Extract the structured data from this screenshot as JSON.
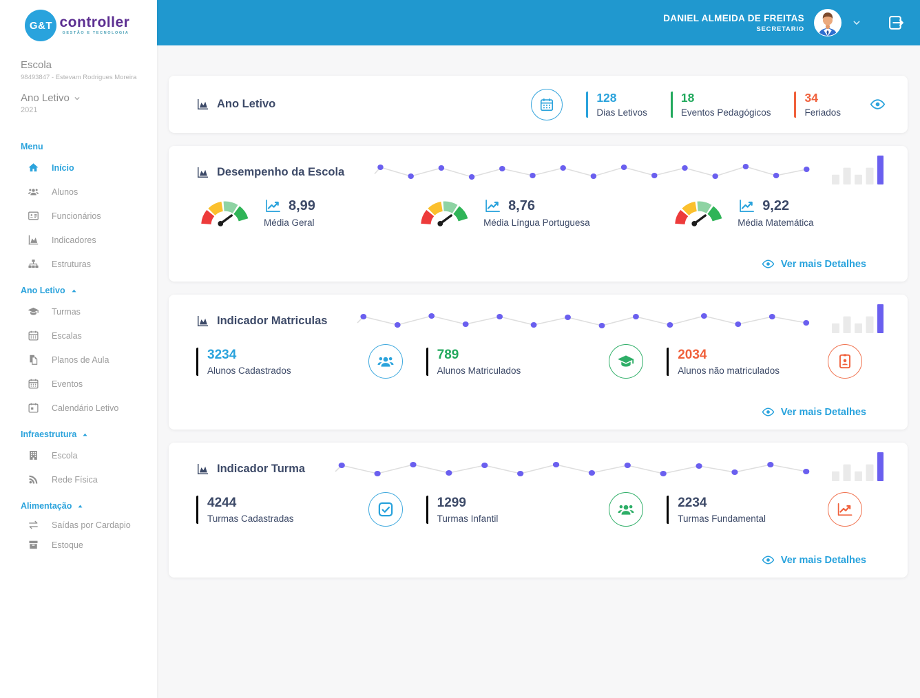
{
  "brand": {
    "circle_text": "G&T",
    "name": "controller",
    "tagline": "GESTÃO E TECNOLOGIA"
  },
  "sidebar": {
    "school_label": "Escola",
    "school_value": "98493847 - Estevam Rodrigues Moreira",
    "year_label": "Ano Letivo",
    "year_value": "2021",
    "sections": [
      {
        "title": "Menu",
        "items": [
          {
            "label": "Início",
            "icon": "home-icon",
            "active": true
          },
          {
            "label": "Alunos",
            "icon": "users-icon"
          },
          {
            "label": "Funcionários",
            "icon": "id-card-icon"
          },
          {
            "label": "Indicadores",
            "icon": "area-chart-icon"
          },
          {
            "label": "Estruturas",
            "icon": "sitemap-icon"
          }
        ]
      },
      {
        "title": "Ano Letivo",
        "items": [
          {
            "label": "Turmas",
            "icon": "graduation-cap-icon"
          },
          {
            "label": "Escalas",
            "icon": "calendar-icon"
          },
          {
            "label": "Planos de Aula",
            "icon": "file-copy-icon"
          },
          {
            "label": "Eventos",
            "icon": "calendar-icon"
          },
          {
            "label": "Calendário Letivo",
            "icon": "calendar-check-icon"
          }
        ]
      },
      {
        "title": "Infraestrutura",
        "items": [
          {
            "label": "Escola",
            "icon": "building-icon"
          },
          {
            "label": "Rede Física",
            "icon": "rss-icon"
          }
        ]
      },
      {
        "title": "Alimentação",
        "items": [
          {
            "label": "Saídas por Cardapio",
            "icon": "exchange-icon"
          },
          {
            "label": "Estoque",
            "icon": "box-icon"
          }
        ]
      }
    ]
  },
  "header": {
    "user_name": "DANIEL ALMEIDA DE FREITAS",
    "user_role": "SECRETARIO"
  },
  "cards": {
    "ano_letivo": {
      "title": "Ano Letivo",
      "stats": [
        {
          "value": "128",
          "label": "Dias Letivos",
          "color": "#2BA3DC"
        },
        {
          "value": "18",
          "label": "Eventos Pedagógicos",
          "color": "#22A95D"
        },
        {
          "value": "34",
          "label": "Feriados",
          "color": "#F0613C"
        }
      ]
    },
    "desempenho": {
      "title": "Desempenho da Escola",
      "metrics": [
        {
          "value": "8,99",
          "label": "Média Geral"
        },
        {
          "value": "8,76",
          "label": "Média Língua Portuguesa"
        },
        {
          "value": "9,22",
          "label": "Média Matemática"
        }
      ],
      "link_label": "Ver mais Detalhes"
    },
    "matriculas": {
      "title": "Indicador Matriculas",
      "stats": [
        {
          "value": "3234",
          "label": "Alunos Cadastrados",
          "icon": "users-icon",
          "color": "#2BA3DC"
        },
        {
          "value": "789",
          "label": "Alunos Matriculados",
          "icon": "graduation-cap-icon",
          "color": "#22A95D"
        },
        {
          "value": "2034",
          "label": "Alunos não matriculados",
          "icon": "id-badge-icon",
          "color": "#F0613C"
        }
      ],
      "link_label": "Ver mais Detalhes"
    },
    "turma": {
      "title": "Indicador Turma",
      "stats": [
        {
          "value": "4244",
          "label": "Turmas Cadastradas",
          "icon": "check-square-icon",
          "color": "#2BA3DC"
        },
        {
          "value": "1299",
          "label": "Turmas Infantil",
          "icon": "users-icon",
          "color": "#22A95D"
        },
        {
          "value": "2234",
          "label": "Turmas Fundamental",
          "icon": "line-chart-icon",
          "color": "#F0613C"
        }
      ],
      "link_label": "Ver mais Detalhes"
    }
  },
  "decor": {
    "sparklines": {
      "desempenho": [
        8,
        21,
        9,
        22,
        10,
        20,
        9,
        21,
        8,
        20,
        9,
        21,
        7,
        20,
        11
      ],
      "matriculas": [
        9,
        21,
        8,
        20,
        9,
        21,
        10,
        22,
        9,
        21,
        8,
        20,
        9,
        18
      ],
      "turma": [
        10,
        22,
        9,
        21,
        10,
        22,
        9,
        21,
        10,
        22,
        11,
        20,
        9,
        19
      ]
    },
    "minibar": {
      "values": [
        34,
        58,
        34,
        58,
        100
      ],
      "highlight_index": 4
    }
  },
  "theme": {
    "header_blue": "#2098CF",
    "accent_blue": "#29A3DD",
    "green": "#22A95D",
    "orange": "#F0613C",
    "navy": "#3D4A68",
    "purple_dot": "#6A5FEF",
    "bar_gray": "#EAEAEA"
  }
}
